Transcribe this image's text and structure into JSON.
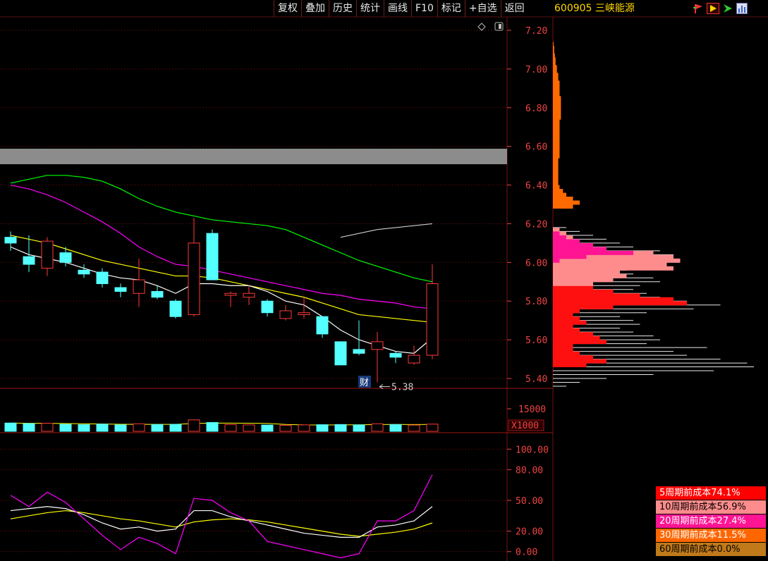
{
  "toolbar": {
    "buttons": [
      "复权",
      "叠加",
      "历史",
      "统计",
      "画线",
      "F10",
      "标记",
      "+自选",
      "返回"
    ]
  },
  "stock": {
    "code_name": "600905 三峡能源"
  },
  "icons": [
    "flag-icon",
    "play-icon",
    "arrow-icon",
    "chart-icon"
  ],
  "price_axis": {
    "ticks": [
      "7.20",
      "7.00",
      "6.80",
      "6.60",
      "6.40",
      "6.20",
      "6.00",
      "5.80",
      "5.60",
      "5.40"
    ],
    "values": [
      7.2,
      7.0,
      6.8,
      6.6,
      6.4,
      6.2,
      6.0,
      5.8,
      5.6,
      5.4
    ]
  },
  "volume_axis": {
    "tick": "15000",
    "multiplier": "X1000"
  },
  "indicator_axis": {
    "ticks": [
      "100.00",
      "80.00",
      "50.00",
      "20.00",
      "0.00"
    ],
    "values": [
      100,
      80,
      50,
      20,
      0
    ]
  },
  "annotations": {
    "low_marker": "5.38",
    "finance_tag": "财"
  },
  "cost_legend": [
    {
      "label": "5周期前成本74.1%",
      "bg": "#ff0000",
      "fg": "#ffffff"
    },
    {
      "label": "10周期前成本56.9%",
      "bg": "#ff8c8c",
      "fg": "#000000"
    },
    {
      "label": "20周期前成本27.4%",
      "bg": "#ff1493",
      "fg": "#ffffff"
    },
    {
      "label": "30周期前成本11.5%",
      "bg": "#ff6600",
      "fg": "#ffffff"
    },
    {
      "label": "60周期前成本0.0%",
      "bg": "#c07a1a",
      "fg": "#000000"
    }
  ],
  "colors": {
    "up": "#ff3a3a",
    "down": "#54ffff",
    "grid": "#7a1010",
    "ma5": "#ffffff",
    "ma10": "#ffff00",
    "ma20": "#ff00ff",
    "ma60": "#00ff00"
  },
  "chart_data": {
    "type": "candlestick",
    "ylim": [
      5.36,
      7.24
    ],
    "candles": [
      {
        "o": 6.13,
        "h": 6.16,
        "l": 6.06,
        "c": 6.1
      },
      {
        "o": 6.03,
        "h": 6.14,
        "l": 5.95,
        "c": 5.99
      },
      {
        "o": 5.97,
        "h": 6.13,
        "l": 5.93,
        "c": 6.11
      },
      {
        "o": 6.05,
        "h": 6.08,
        "l": 5.98,
        "c": 6.0
      },
      {
        "o": 5.96,
        "h": 5.99,
        "l": 5.92,
        "c": 5.94
      },
      {
        "o": 5.95,
        "h": 5.97,
        "l": 5.87,
        "c": 5.89
      },
      {
        "o": 5.87,
        "h": 5.89,
        "l": 5.82,
        "c": 5.85
      },
      {
        "o": 5.84,
        "h": 6.02,
        "l": 5.77,
        "c": 5.91
      },
      {
        "o": 5.85,
        "h": 5.88,
        "l": 5.81,
        "c": 5.82
      },
      {
        "o": 5.8,
        "h": 5.81,
        "l": 5.71,
        "c": 5.72
      },
      {
        "o": 5.73,
        "h": 6.23,
        "l": 5.72,
        "c": 6.1
      },
      {
        "o": 6.15,
        "h": 6.17,
        "l": 5.91,
        "c": 5.91
      },
      {
        "o": 5.83,
        "h": 5.85,
        "l": 5.77,
        "c": 5.84
      },
      {
        "o": 5.82,
        "h": 5.88,
        "l": 5.78,
        "c": 5.84
      },
      {
        "o": 5.8,
        "h": 5.81,
        "l": 5.72,
        "c": 5.74
      },
      {
        "o": 5.71,
        "h": 5.78,
        "l": 5.7,
        "c": 5.75
      },
      {
        "o": 5.73,
        "h": 5.82,
        "l": 5.71,
        "c": 5.74
      },
      {
        "o": 5.72,
        "h": 5.72,
        "l": 5.61,
        "c": 5.63
      },
      {
        "o": 5.59,
        "h": 5.59,
        "l": 5.47,
        "c": 5.47
      },
      {
        "o": 5.55,
        "h": 5.7,
        "l": 5.52,
        "c": 5.53
      },
      {
        "o": 5.55,
        "h": 5.64,
        "l": 5.38,
        "c": 5.59
      },
      {
        "o": 5.53,
        "h": 5.54,
        "l": 5.48,
        "c": 5.51
      },
      {
        "o": 5.48,
        "h": 5.57,
        "l": 5.47,
        "c": 5.52
      },
      {
        "o": 5.52,
        "h": 5.99,
        "l": 5.5,
        "c": 5.89
      }
    ],
    "ma5": [
      6.08,
      6.04,
      6.02,
      6.0,
      5.97,
      5.94,
      5.92,
      5.91,
      5.88,
      5.84,
      5.89,
      5.89,
      5.88,
      5.88,
      5.85,
      5.8,
      5.78,
      5.72,
      5.65,
      5.6,
      5.57,
      5.54,
      5.53,
      5.61
    ],
    "ma10": [
      6.14,
      6.12,
      6.1,
      6.07,
      6.04,
      6.01,
      5.99,
      5.97,
      5.95,
      5.93,
      5.93,
      5.92,
      5.9,
      5.88,
      5.86,
      5.84,
      5.82,
      5.79,
      5.76,
      5.73,
      5.72,
      5.71,
      5.7,
      5.69
    ],
    "ma20": [
      6.4,
      6.38,
      6.35,
      6.31,
      6.26,
      6.21,
      6.15,
      6.08,
      6.03,
      5.99,
      5.98,
      5.96,
      5.94,
      5.92,
      5.9,
      5.88,
      5.86,
      5.84,
      5.83,
      5.81,
      5.8,
      5.79,
      5.77,
      5.76
    ],
    "ma60": [
      6.41,
      6.43,
      6.45,
      6.45,
      6.44,
      6.42,
      6.38,
      6.33,
      6.29,
      6.26,
      6.24,
      6.22,
      6.21,
      6.2,
      6.19,
      6.17,
      6.13,
      6.09,
      6.05,
      6.01,
      5.98,
      5.95,
      5.92,
      5.9
    ],
    "ma_extra_start": 18,
    "ma_extra": [
      6.13,
      6.15,
      6.17,
      6.18,
      6.19,
      6.2
    ],
    "volume_ylim": [
      0,
      18000
    ],
    "volume": [
      4500,
      4200,
      4400,
      3800,
      3600,
      3900,
      3500,
      4100,
      3700,
      3800,
      6200,
      4800,
      3700,
      3500,
      3400,
      3300,
      3500,
      3600,
      3700,
      3500,
      4100,
      3700,
      3400,
      3900
    ],
    "indicator_ylim": [
      -5,
      105
    ],
    "k": [
      40,
      42,
      44,
      42,
      36,
      28,
      22,
      24,
      20,
      22,
      40,
      40,
      34,
      30,
      26,
      22,
      18,
      16,
      14,
      14,
      24,
      26,
      30,
      44
    ],
    "d": [
      32,
      35,
      38,
      40,
      38,
      35,
      32,
      30,
      27,
      24,
      29,
      31,
      32,
      31,
      29,
      26,
      23,
      20,
      17,
      15,
      17,
      19,
      22,
      28
    ],
    "j": [
      55,
      44,
      58,
      48,
      32,
      16,
      2,
      14,
      8,
      -2,
      52,
      50,
      38,
      30,
      10,
      6,
      2,
      -2,
      -6,
      -2,
      30,
      30,
      40,
      75
    ],
    "cost_distribution": {
      "bins": [
        5.36,
        5.38,
        5.4,
        5.42,
        5.44,
        5.46,
        5.48,
        5.5,
        5.52,
        5.54,
        5.56,
        5.58,
        5.6,
        5.62,
        5.64,
        5.66,
        5.68,
        5.7,
        5.72,
        5.74,
        5.76,
        5.78,
        5.8,
        5.82,
        5.84,
        5.86,
        5.88,
        5.9,
        5.92,
        5.94,
        5.96,
        5.98,
        6.0,
        6.02,
        6.04,
        6.06,
        6.08,
        6.1,
        6.12,
        6.14,
        6.16,
        6.18,
        6.2,
        6.22,
        6.24,
        6.26,
        6.28,
        6.3,
        6.32,
        6.34,
        6.36,
        6.38,
        6.4,
        6.42,
        6.44,
        6.46,
        6.48,
        6.5,
        6.52,
        6.54,
        6.56,
        6.58,
        6.6,
        6.62,
        6.64,
        6.66,
        6.68,
        6.7,
        6.72,
        6.74,
        6.76,
        6.78,
        6.8,
        6.82,
        6.84,
        6.86,
        6.88,
        6.9,
        6.92,
        6.94,
        6.96,
        6.98,
        7.0,
        7.02,
        7.04,
        7.06,
        7.08,
        7.1,
        7.12,
        7.14
      ],
      "white": [
        20,
        40,
        80,
        150,
        240,
        300,
        290,
        250,
        200,
        180,
        230,
        140,
        160,
        150,
        120,
        100,
        130,
        120,
        100,
        140,
        210,
        250,
        200,
        160,
        140,
        120,
        130,
        160,
        150,
        120,
        110,
        130,
        150,
        170,
        180,
        160,
        120,
        100,
        80,
        60,
        40,
        20,
        0,
        0,
        0,
        0,
        0,
        0,
        0,
        0,
        0,
        0,
        0,
        0,
        0,
        0,
        0,
        0,
        0,
        0,
        0,
        0,
        0,
        0,
        0,
        0,
        0,
        0,
        0,
        0,
        0,
        0,
        0,
        0,
        0,
        0,
        0,
        0,
        0,
        0,
        0,
        0,
        0,
        0,
        0,
        0,
        0,
        0,
        0,
        0
      ],
      "red": [
        0,
        0,
        0,
        0,
        0,
        50,
        80,
        60,
        40,
        30,
        30,
        80,
        70,
        60,
        40,
        30,
        50,
        40,
        30,
        40,
        90,
        200,
        180,
        130,
        90,
        60,
        40,
        30,
        20,
        10,
        5,
        0,
        0,
        0,
        0,
        0,
        0,
        0,
        0,
        0,
        0,
        0,
        0,
        0,
        0,
        0,
        0,
        0,
        0,
        0,
        0,
        0,
        0,
        0,
        0,
        0,
        0,
        0,
        0,
        0,
        0,
        0,
        0,
        0,
        0,
        0,
        0,
        0,
        0,
        0,
        0,
        0,
        0,
        0,
        0,
        0,
        0,
        0,
        0,
        0,
        0,
        0,
        0,
        0,
        0,
        0,
        0,
        0,
        0,
        0
      ],
      "pink": [
        0,
        0,
        0,
        0,
        0,
        0,
        0,
        0,
        0,
        0,
        0,
        0,
        0,
        0,
        0,
        0,
        0,
        0,
        0,
        0,
        0,
        0,
        0,
        0,
        0,
        0,
        60,
        90,
        110,
        100,
        180,
        170,
        190,
        180,
        150,
        80,
        60,
        40,
        30,
        20,
        10,
        0,
        0,
        0,
        0,
        0,
        0,
        0,
        0,
        0,
        0,
        0,
        0,
        0,
        0,
        0,
        0,
        0,
        0,
        0,
        0,
        0,
        0,
        0,
        0,
        0,
        0,
        0,
        0,
        0,
        0,
        0,
        0,
        0,
        0,
        0,
        0,
        0,
        0,
        0,
        0,
        0,
        0,
        0,
        0,
        0,
        0,
        0,
        0,
        0
      ],
      "magenta": [
        0,
        0,
        0,
        0,
        0,
        0,
        0,
        0,
        0,
        0,
        0,
        0,
        0,
        0,
        0,
        0,
        0,
        0,
        0,
        0,
        0,
        0,
        0,
        0,
        0,
        0,
        0,
        0,
        0,
        0,
        0,
        0,
        10,
        50,
        120,
        80,
        60,
        40,
        20,
        10,
        0,
        0,
        0,
        0,
        0,
        0,
        0,
        0,
        0,
        0,
        0,
        0,
        0,
        0,
        0,
        0,
        0,
        0,
        0,
        0,
        0,
        0,
        0,
        0,
        0,
        0,
        0,
        0,
        0,
        0,
        0,
        0,
        0,
        0,
        0,
        0,
        0,
        0,
        0,
        0,
        0,
        0,
        0,
        0,
        0,
        0,
        0,
        0,
        0,
        0
      ],
      "orange": [
        0,
        0,
        0,
        0,
        0,
        0,
        0,
        0,
        0,
        0,
        0,
        0,
        0,
        0,
        0,
        0,
        0,
        0,
        0,
        0,
        0,
        0,
        0,
        0,
        0,
        0,
        0,
        0,
        0,
        0,
        0,
        0,
        0,
        0,
        0,
        0,
        0,
        0,
        0,
        0,
        0,
        0,
        0,
        0,
        0,
        0,
        30,
        40,
        30,
        20,
        15,
        10,
        8,
        8,
        8,
        8,
        8,
        8,
        8,
        10,
        10,
        10,
        10,
        10,
        10,
        10,
        10,
        10,
        10,
        12,
        12,
        12,
        12,
        12,
        12,
        10,
        10,
        10,
        10,
        8,
        8,
        6,
        6,
        4,
        4,
        3,
        2,
        2,
        1,
        0
      ]
    }
  }
}
